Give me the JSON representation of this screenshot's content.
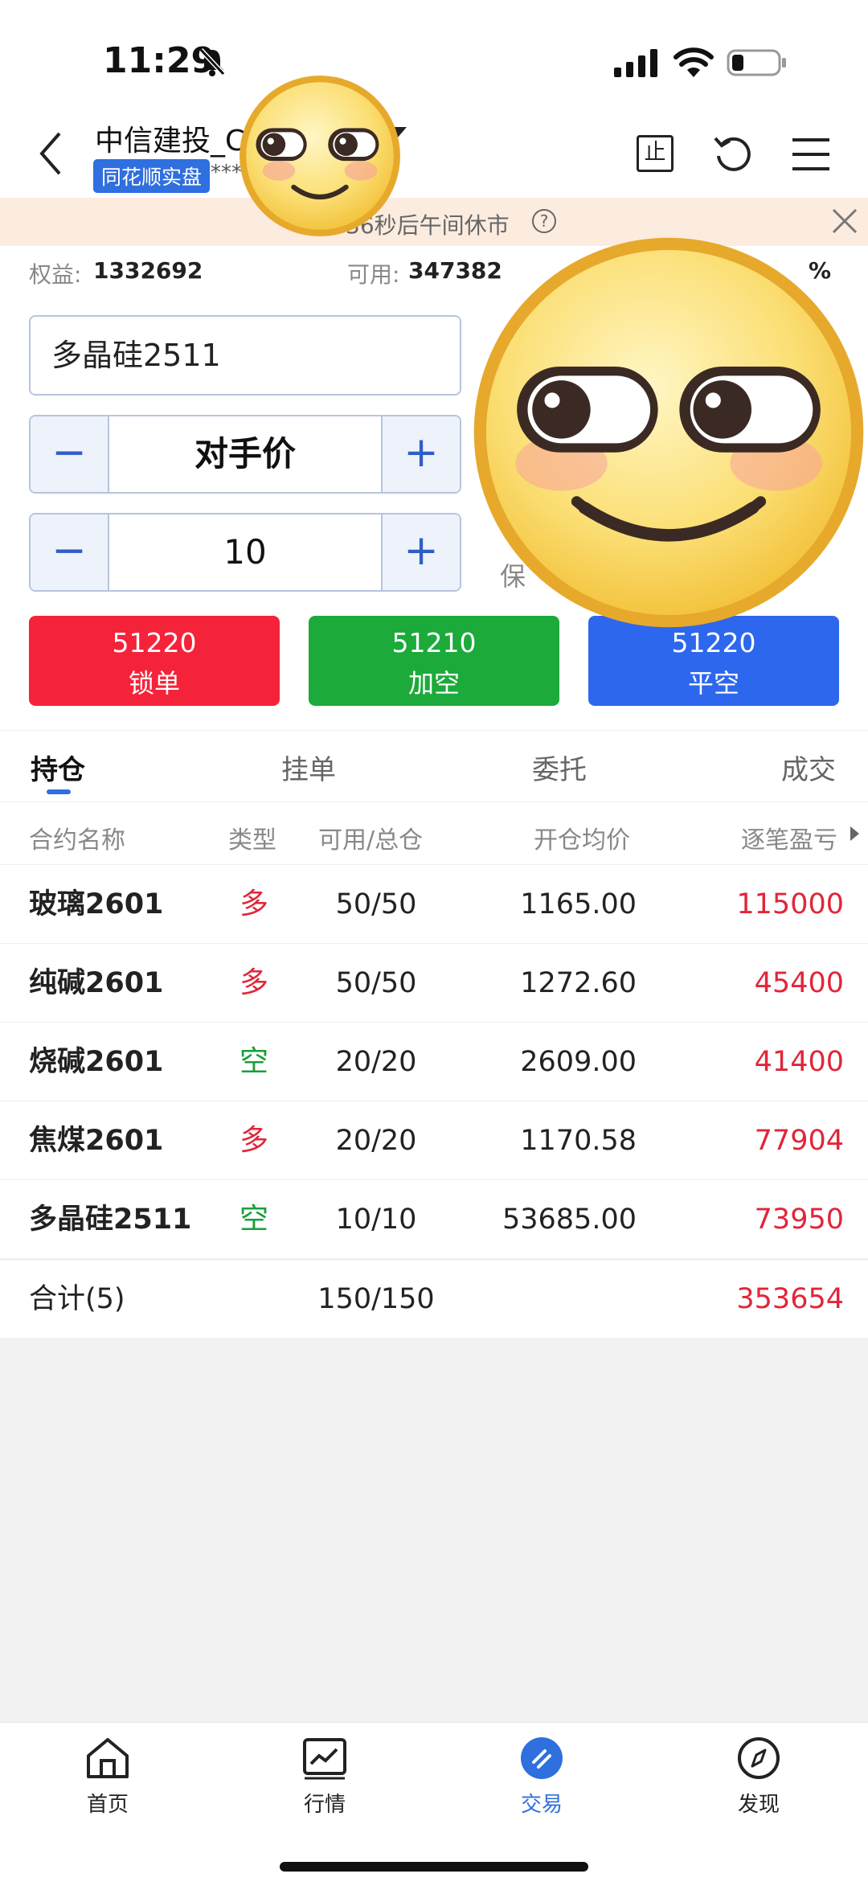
{
  "status_bar": {
    "time": "11:29"
  },
  "header": {
    "account_title": "中信建投_C",
    "badge": "同花顺实盘",
    "account_mask": "***",
    "stop_icon_text": "止"
  },
  "notice": {
    "text": "36秒后午间休市",
    "help": "?"
  },
  "equity": {
    "equity_label": "权益:",
    "equity_value": "1332692",
    "available_label": "可用:",
    "available_value": "347382",
    "ratio_tail": "%"
  },
  "order": {
    "contract": "多晶硅2511",
    "price_mode": "对手价",
    "quantity": "10",
    "minus": "−",
    "plus": "+",
    "margin_label": "保",
    "buttons": [
      {
        "price": "51220",
        "label": "锁单",
        "color": "#f5233a"
      },
      {
        "price": "51210",
        "label": "加空",
        "color": "#1caa3b"
      },
      {
        "price": "51220",
        "label": "平空",
        "color": "#2d67ed"
      }
    ]
  },
  "tabs": [
    "持仓",
    "挂单",
    "委托",
    "成交"
  ],
  "table": {
    "headers": [
      "合约名称",
      "类型",
      "可用/总仓",
      "开仓均价",
      "逐笔盈亏"
    ],
    "rows": [
      {
        "name": "玻璃2601",
        "type": "多",
        "avail": "50/50",
        "avg": "1165.00",
        "pnl": "115000"
      },
      {
        "name": "纯碱2601",
        "type": "多",
        "avail": "50/50",
        "avg": "1272.60",
        "pnl": "45400"
      },
      {
        "name": "烧碱2601",
        "type": "空",
        "avail": "20/20",
        "avg": "2609.00",
        "pnl": "41400"
      },
      {
        "name": "焦煤2601",
        "type": "多",
        "avail": "20/20",
        "avg": "1170.58",
        "pnl": "77904"
      },
      {
        "name": "多晶硅2511",
        "type": "空",
        "avail": "10/10",
        "avg": "53685.00",
        "pnl": "73950"
      }
    ],
    "total": {
      "label": "合计(5)",
      "avail": "150/150",
      "pnl": "353654"
    }
  },
  "nav": [
    {
      "label": "首页",
      "icon": "home-icon"
    },
    {
      "label": "行情",
      "icon": "chart-icon"
    },
    {
      "label": "交易",
      "icon": "trade-icon"
    },
    {
      "label": "发现",
      "icon": "compass-icon"
    }
  ]
}
